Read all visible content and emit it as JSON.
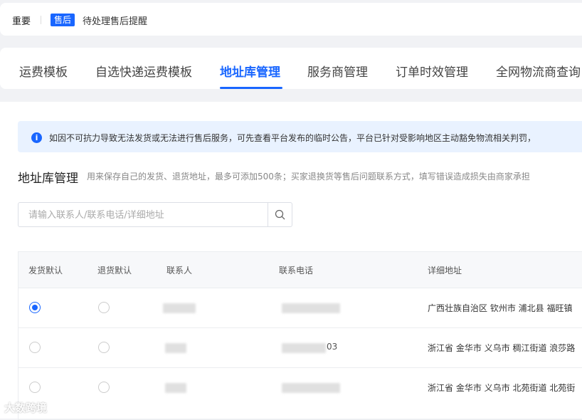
{
  "notice": {
    "important": "重要",
    "tag": "售后",
    "text": "待处理售后提醒"
  },
  "tabs": [
    {
      "label": "运费模板",
      "active": false
    },
    {
      "label": "自选快递运费模板",
      "active": false
    },
    {
      "label": "地址库管理",
      "active": true
    },
    {
      "label": "服务商管理",
      "active": false
    },
    {
      "label": "订单时效管理",
      "active": false
    },
    {
      "label": "全网物流商查询",
      "active": false
    }
  ],
  "banner": {
    "text": "如因不可抗力导致无法发货或无法进行售后服务，可先查看平台发布的临时公告，平台已针对受影响地区主动豁免物流相关判罚，"
  },
  "section": {
    "title": "地址库管理",
    "description": "用来保存自己的发货、退货地址，最多可添加500条；买家退换货等售后问题联系方式，填写错误造成损失由商家承担"
  },
  "search": {
    "placeholder": "请输入联系人/联系电话/详细地址",
    "value": ""
  },
  "table": {
    "headers": [
      "发货默认",
      "退货默认",
      "联系人",
      "联系电话",
      "详细地址"
    ],
    "rows": [
      {
        "ship_default": true,
        "return_default": false,
        "contact": "",
        "phone": "",
        "address": "广西壮族自治区 钦州市 浦北县 福旺镇"
      },
      {
        "ship_default": false,
        "return_default": false,
        "contact": "",
        "phone": "03",
        "address": "浙江省 金华市 义乌市 稠江街道 浪莎路"
      },
      {
        "ship_default": false,
        "return_default": false,
        "contact": "",
        "phone": "",
        "address": "浙江省 金华市 义乌市 北苑街道 北苑街"
      }
    ]
  },
  "watermark": "大数跨境",
  "colors": {
    "accent": "#1966ff",
    "banner_bg": "#e9f2ff"
  }
}
